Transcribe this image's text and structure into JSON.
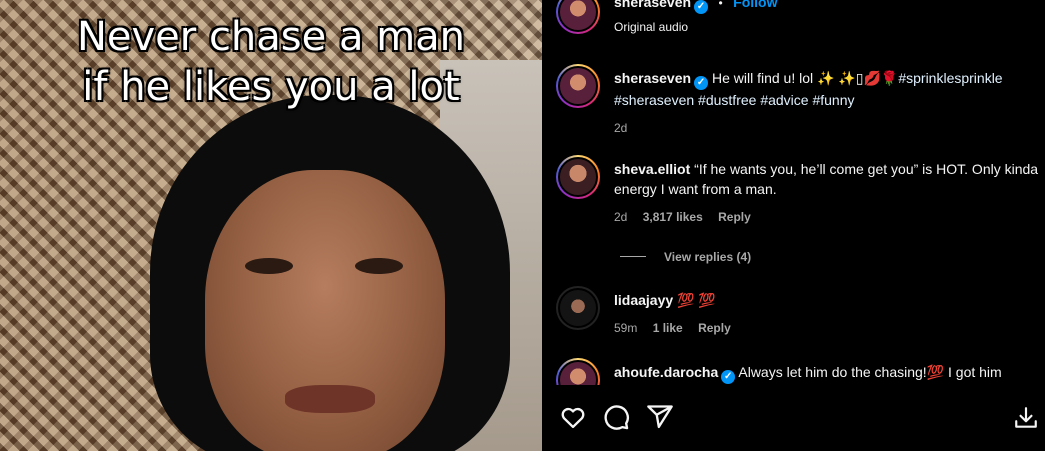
{
  "video": {
    "caption_line1": "Never chase a man",
    "caption_line2": "if he likes you a lot"
  },
  "header": {
    "username": "sheraseven",
    "separator": "•",
    "follow_label": "Follow",
    "audio": "Original audio"
  },
  "comments": [
    {
      "username": "sheraseven",
      "text": "He will find u! lol ✨ ✨▯💋🌹",
      "hashtags": "#sprinklesprinkle #sheraseven #dustfree #advice #funny",
      "time": "2d"
    },
    {
      "username": "sheva.elliot",
      "text": "“If he wants you, he’ll come get you” is HOT. Only kinda energy I want from a man.",
      "time": "2d",
      "likes": "3,817 likes",
      "reply": "Reply",
      "view_replies": "View replies (4)"
    },
    {
      "username": "lidaajayy",
      "text": "💯 💯",
      "time": "59m",
      "likes": "1 like",
      "reply": "Reply"
    },
    {
      "username": "ahoufe.darocha",
      "text": "Always let him do the chasing!💯 I got him"
    }
  ],
  "icons": [
    "heart-icon",
    "comment-icon",
    "share-icon",
    "save-icon"
  ],
  "colors": {
    "accent": "#0095f6",
    "muted": "#a8a8a8",
    "background": "#000000"
  }
}
